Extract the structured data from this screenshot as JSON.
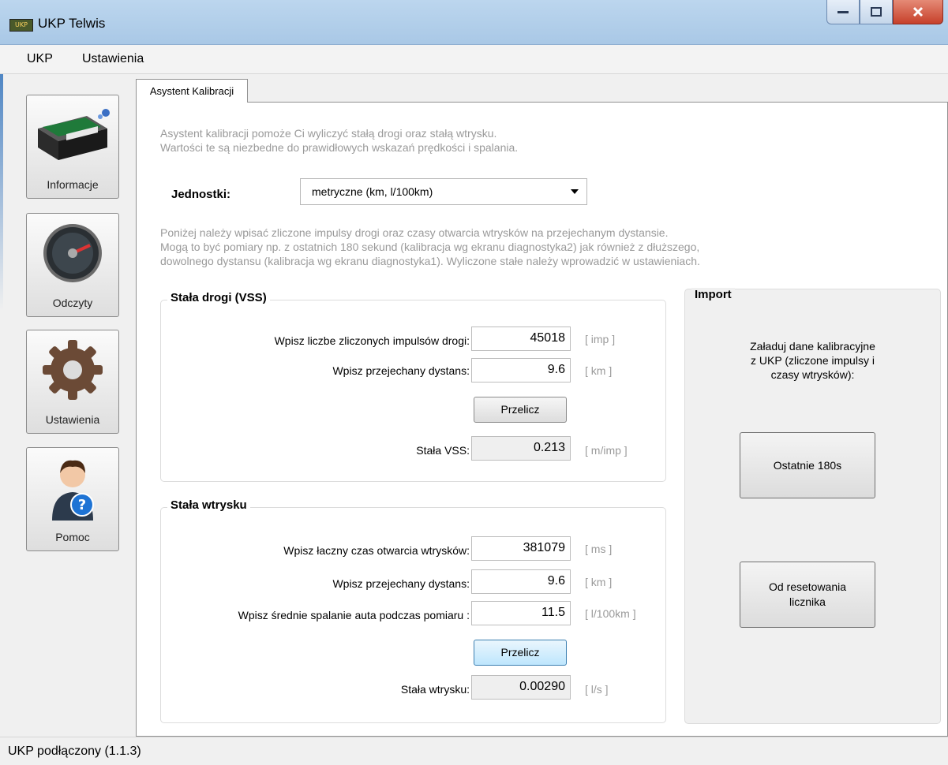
{
  "window": {
    "title": "UKP Telwis",
    "app_icon_text": "UKP"
  },
  "menu": {
    "items": [
      "UKP",
      "Ustawienia"
    ]
  },
  "sidebar": {
    "items": [
      {
        "label": "Informacje",
        "icon": "device-icon"
      },
      {
        "label": "Odczyty",
        "icon": "gauge-icon"
      },
      {
        "label": "Ustawienia",
        "icon": "gear-icon"
      },
      {
        "label": "Pomoc",
        "icon": "help-person-icon"
      }
    ]
  },
  "tab": {
    "label": "Asystent Kalibracji"
  },
  "intro": {
    "line1": "Asystent kalibracji pomoże Ci wyliczyć stałą drogi oraz stałą wtrysku.",
    "line2": "Wartości te są niezbedne do prawidłowych wskazań prędkości i spalania."
  },
  "units": {
    "label": "Jednostki:",
    "selected": "metryczne (km, l/100km)"
  },
  "instructions": {
    "line1": "Poniżej należy wpisać zliczone impulsy drogi oraz czasy otwarcia wtrysków na przejechanym dystansie.",
    "line2": "Mogą to być pomiary np. z ostatnich 180 sekund (kalibracja wg ekranu diagnostyka2) jak również z dłuższego,",
    "line3": "dowolnego dystansu (kalibracja wg ekranu diagnostyka1). Wyliczone stałe należy wprowadzić w ustawieniach."
  },
  "vss": {
    "title": "Stała drogi (VSS)",
    "pulses_label": "Wpisz liczbe zliczonych impulsów drogi:",
    "pulses_value": "45018",
    "pulses_unit": "[ imp ]",
    "distance_label": "Wpisz przejechany dystans:",
    "distance_value": "9.6",
    "distance_unit": "[ km ]",
    "calc_button": "Przelicz",
    "result_label": "Stała VSS:",
    "result_value": "0.213",
    "result_unit": "[ m/imp ]"
  },
  "injection": {
    "title": "Stała wtrysku",
    "time_label": "Wpisz łaczny czas otwarcia wtrysków:",
    "time_value": "381079",
    "time_unit": "[ ms ]",
    "distance_label": "Wpisz przejechany dystans:",
    "distance_value": "9.6",
    "distance_unit": "[ km ]",
    "consumption_label": "Wpisz średnie spalanie auta podczas pomiaru :",
    "consumption_value": "11.5",
    "consumption_unit": "[ l/100km ]",
    "calc_button": "Przelicz",
    "result_label": "Stała wtrysku:",
    "result_value": "0.00290",
    "result_unit": "[ l/s ]"
  },
  "import": {
    "title": "Import",
    "line1": "Załaduj dane kalibracyjne",
    "line2": "z UKP (zliczone impulsy i",
    "line3": "czasy wtrysków):",
    "last_button": "Ostatnie 180s",
    "reset_button_line1": "Od resetowania",
    "reset_button_line2": "licznika"
  },
  "status": {
    "text": "UKP podłączony (1.1.3)"
  }
}
